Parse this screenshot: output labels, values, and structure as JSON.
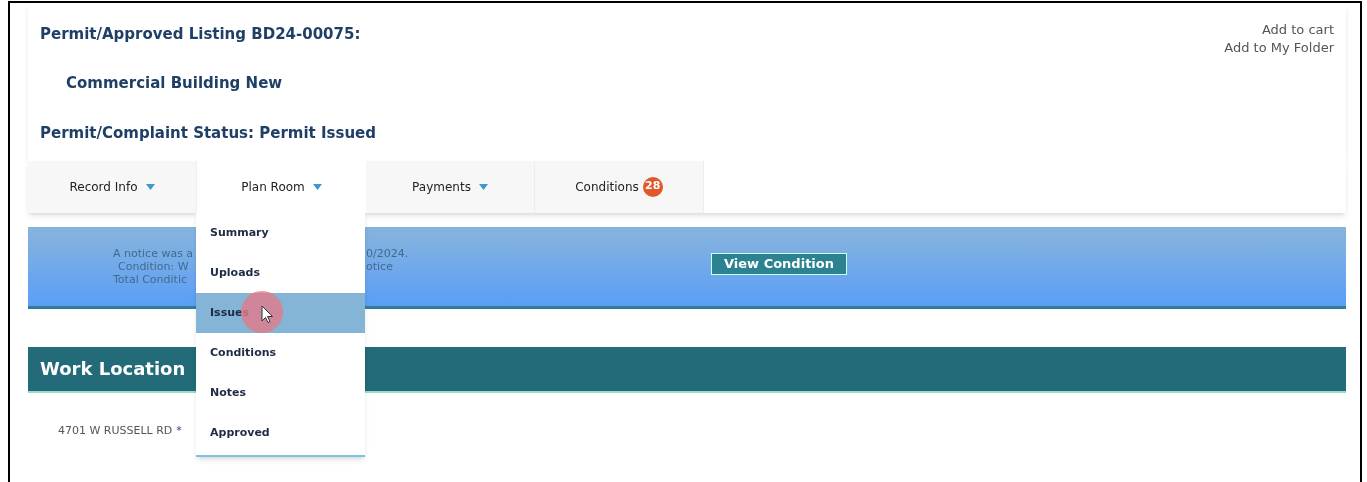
{
  "header": {
    "title": "Permit/Approved Listing BD24-00075:",
    "type": "Commercial Building New",
    "status": "Permit/Complaint Status: Permit Issued",
    "links": [
      "Add to cart",
      "Add to My Folder"
    ]
  },
  "tabs": [
    {
      "label": "Record Info",
      "selected": false,
      "caret": true
    },
    {
      "label": "Plan Room",
      "selected": true,
      "caret": true
    },
    {
      "label": "Payments",
      "selected": false,
      "caret": true
    },
    {
      "label": "Conditions",
      "selected": false,
      "caret": false,
      "badge": "28"
    }
  ],
  "menu": {
    "items": [
      {
        "label": "Summary",
        "selected": false
      },
      {
        "label": "Uploads",
        "selected": false
      },
      {
        "label": "Issues",
        "selected": true
      },
      {
        "label": "Conditions",
        "selected": false
      },
      {
        "label": "Notes",
        "selected": false
      },
      {
        "label": "Approved",
        "selected": false
      }
    ]
  },
  "notice": {
    "left_lines": [
      "A notice was a",
      "Condition: W",
      "Total Conditic"
    ],
    "right_lines": [
      "0/2024.",
      "otice"
    ],
    "button": "View Condition"
  },
  "work_location": {
    "title": "Work Location",
    "address": "4701 W RUSSELL RD",
    "required_mark": "*"
  }
}
